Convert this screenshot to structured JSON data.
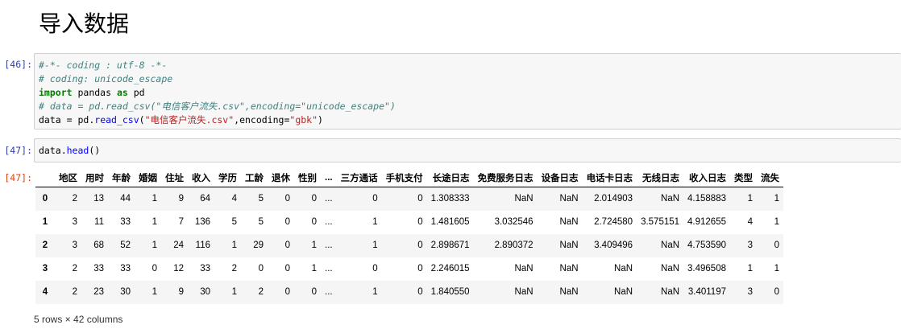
{
  "heading": "导入数据",
  "cells": [
    {
      "prompt": "[46]:",
      "lines": [
        [
          {
            "t": "#-*- coding : utf-8 -*-",
            "c": "cm"
          }
        ],
        [
          {
            "t": "# coding: unicode_escape",
            "c": "cm"
          }
        ],
        [
          {
            "t": "import",
            "c": "kw"
          },
          {
            "t": " pandas ",
            "c": ""
          },
          {
            "t": "as",
            "c": "kw"
          },
          {
            "t": " pd",
            "c": ""
          }
        ],
        [
          {
            "t": "# data = pd.read_csv(\"电信客户流失.csv\",encoding=\"unicode_escape\")",
            "c": "cm"
          }
        ],
        [
          {
            "t": "data ",
            "c": ""
          },
          {
            "t": "=",
            "c": ""
          },
          {
            "t": " pd.",
            "c": ""
          },
          {
            "t": "read_csv",
            "c": "fn"
          },
          {
            "t": "(",
            "c": ""
          },
          {
            "t": "\"电信客户流失.csv\"",
            "c": "st"
          },
          {
            "t": ",encoding=",
            "c": ""
          },
          {
            "t": "\"gbk\"",
            "c": "st"
          },
          {
            "t": ")",
            "c": ""
          }
        ]
      ]
    },
    {
      "prompt": "[47]:",
      "lines": [
        [
          {
            "t": "data.",
            "c": ""
          },
          {
            "t": "head",
            "c": "fn"
          },
          {
            "t": "()",
            "c": ""
          }
        ]
      ]
    }
  ],
  "output": {
    "prompt": "[47]:",
    "columns": [
      "",
      "地区",
      "用时",
      "年龄",
      "婚姻",
      "住址",
      "收入",
      "学历",
      "工龄",
      "退休",
      "性别",
      "...",
      "三方通话",
      "手机支付",
      "长途日志",
      "免费服务日志",
      "设备日志",
      "电话卡日志",
      "无线日志",
      "收入日志",
      "类型",
      "流失"
    ],
    "rows": [
      [
        "0",
        "2",
        "13",
        "44",
        "1",
        "9",
        "64",
        "4",
        "5",
        "0",
        "0",
        "...",
        "0",
        "0",
        "1.308333",
        "NaN",
        "NaN",
        "2.014903",
        "NaN",
        "4.158883",
        "1",
        "1"
      ],
      [
        "1",
        "3",
        "11",
        "33",
        "1",
        "7",
        "136",
        "5",
        "5",
        "0",
        "0",
        "...",
        "1",
        "0",
        "1.481605",
        "3.032546",
        "NaN",
        "2.724580",
        "3.575151",
        "4.912655",
        "4",
        "1"
      ],
      [
        "2",
        "3",
        "68",
        "52",
        "1",
        "24",
        "116",
        "1",
        "29",
        "0",
        "1",
        "...",
        "1",
        "0",
        "2.898671",
        "2.890372",
        "NaN",
        "3.409496",
        "NaN",
        "4.753590",
        "3",
        "0"
      ],
      [
        "3",
        "2",
        "33",
        "33",
        "0",
        "12",
        "33",
        "2",
        "0",
        "0",
        "1",
        "...",
        "0",
        "0",
        "2.246015",
        "NaN",
        "NaN",
        "NaN",
        "NaN",
        "3.496508",
        "1",
        "1"
      ],
      [
        "4",
        "2",
        "23",
        "30",
        "1",
        "9",
        "30",
        "1",
        "2",
        "0",
        "0",
        "...",
        "1",
        "0",
        "1.840550",
        "NaN",
        "NaN",
        "NaN",
        "NaN",
        "3.401197",
        "3",
        "0"
      ]
    ],
    "shape": "5 rows × 42 columns"
  }
}
